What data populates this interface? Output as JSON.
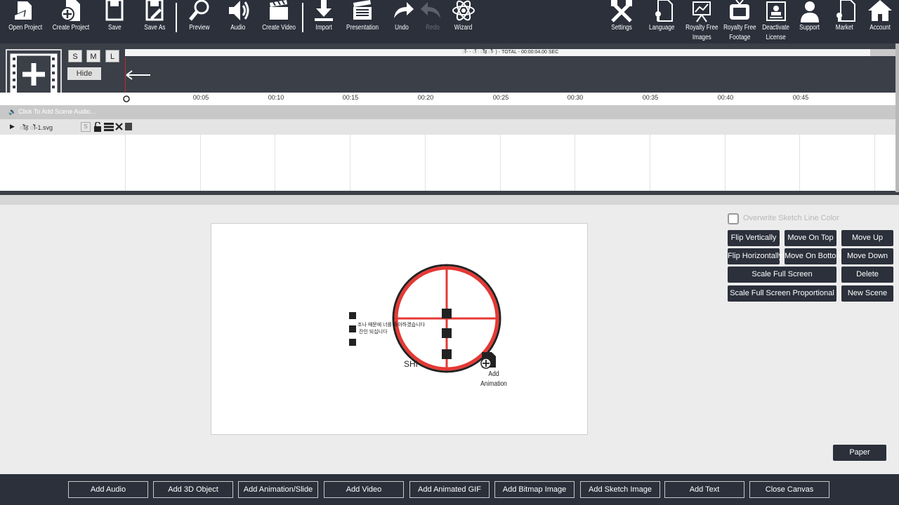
{
  "toolbar": {
    "left": [
      {
        "id": "open-project",
        "label": "Open Project",
        "icon": "folder-open-icon"
      },
      {
        "id": "create-project",
        "label": "Create Project",
        "icon": "add-document-icon"
      },
      {
        "id": "save",
        "label": "Save",
        "icon": "save-icon"
      },
      {
        "id": "save-as",
        "label": "Save As",
        "icon": "save-as-icon"
      },
      {
        "id": "preview",
        "label": "Preview",
        "icon": "magnifier-icon"
      },
      {
        "id": "audio",
        "label": "Audio",
        "icon": "speaker-icon"
      },
      {
        "id": "create-video",
        "label": "Create Video",
        "icon": "clapperboard-icon"
      },
      {
        "id": "import",
        "label": "Import",
        "icon": "download-icon"
      },
      {
        "id": "presentation",
        "label": "Presentation",
        "icon": "presentation-icon"
      },
      {
        "id": "undo",
        "label": "Undo",
        "icon": "undo-icon"
      },
      {
        "id": "redo",
        "label": "Redo",
        "icon": "redo-icon",
        "disabled": true
      },
      {
        "id": "wizard",
        "label": "Wizard",
        "icon": "atom-icon"
      }
    ],
    "right": [
      {
        "id": "settings",
        "label": "Settings",
        "icon": "tools-icon"
      },
      {
        "id": "language",
        "label": "Language",
        "icon": "language-document-icon"
      },
      {
        "id": "royalty-free-images",
        "label": "Royalty Free\nImages",
        "icon": "image-chart-icon"
      },
      {
        "id": "royalty-free-footage",
        "label": "Royalty Free\nFootage",
        "icon": "tv-icon"
      },
      {
        "id": "deactivate-license",
        "label": "Deactivate\nLicense",
        "icon": "id-card-icon"
      },
      {
        "id": "support",
        "label": "Support",
        "icon": "person-icon"
      },
      {
        "id": "market",
        "label": "Market",
        "icon": "cart-document-icon"
      },
      {
        "id": "account",
        "label": "Account",
        "icon": "home-icon"
      }
    ]
  },
  "timeline": {
    "size_buttons": [
      "S",
      "M",
      "L"
    ],
    "hide_label": "Hide",
    "track_title": "ॉ- - ॉ : ॉेह ॉे- ) - TOTAL - 00:00:04.00 SEC",
    "ticks": [
      "00:05",
      "00:10",
      "00:15",
      "00:20",
      "00:25",
      "00:30",
      "00:35",
      "00:40",
      "00:45"
    ],
    "audio_label": "Click To Add Scene Audio...",
    "layer": {
      "name": "ॉेह ॉे-1.svg",
      "size_badge": "S"
    }
  },
  "canvas": {
    "add_animation_label": "Add\nAnimation",
    "shi_label": "SHI",
    "korean_text": "조나 때문에 너를 좋아하겠습니다\n 잔인 되십니다"
  },
  "panel": {
    "overwrite_label": "Overwrite Sketch Line Color",
    "buttons": {
      "flip_vertically": "Flip Vertically",
      "move_on_top": "Move On Top",
      "move_up": "Move Up",
      "flip_horizontally": "Flip Horizontally",
      "move_on_bottom": "Move On Bottom",
      "move_down": "Move Down",
      "scale_full_screen": "Scale Full Screen",
      "delete": "Delete",
      "scale_full_screen_proportional": "Scale Full Screen Proportional",
      "new_scene": "New Scene"
    },
    "paper_label": "Paper"
  },
  "bottombar": {
    "buttons": [
      "Add Audio",
      "Add 3D Object",
      "Add Animation/Slide",
      "Add Video",
      "Add Animated GIF",
      "Add Bitmap Image",
      "Add Sketch Image",
      "Add Text",
      "Close Canvas"
    ]
  },
  "colors": {
    "dark": "#2b303b",
    "accent_red": "#e53935",
    "timeline_bg": "#3a3f48"
  }
}
